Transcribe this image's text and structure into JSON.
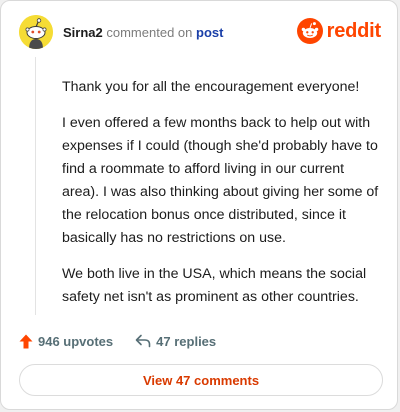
{
  "header": {
    "username": "Sirna2",
    "commented_text": "commented on",
    "post_link": "post",
    "logo_wordmark": "reddit",
    "avatar_icon": "snoo-avatar-icon",
    "logo_icon": "reddit-snoo-icon"
  },
  "comment": {
    "paragraphs": [
      "Thank you for all the encouragement everyone!",
      "I even offered a few months back to help out with expenses if I could (though she'd probably have to find a roommate to afford living in our current area). I was also thinking about giving her some of the relocation bonus once distributed, since it basically has no restrictions on use.",
      "We both live in the USA, which means the social safety net isn't as prominent as other countries."
    ]
  },
  "actions": {
    "upvotes_label": "946 upvotes",
    "replies_label": "47 replies"
  },
  "footer": {
    "view_comments_label": "View 47 comments"
  },
  "colors": {
    "brand": "#ff4500",
    "link": "#1a3fa8",
    "view_button_text": "#d93a00",
    "avatar_bg": "#f5dc35"
  }
}
